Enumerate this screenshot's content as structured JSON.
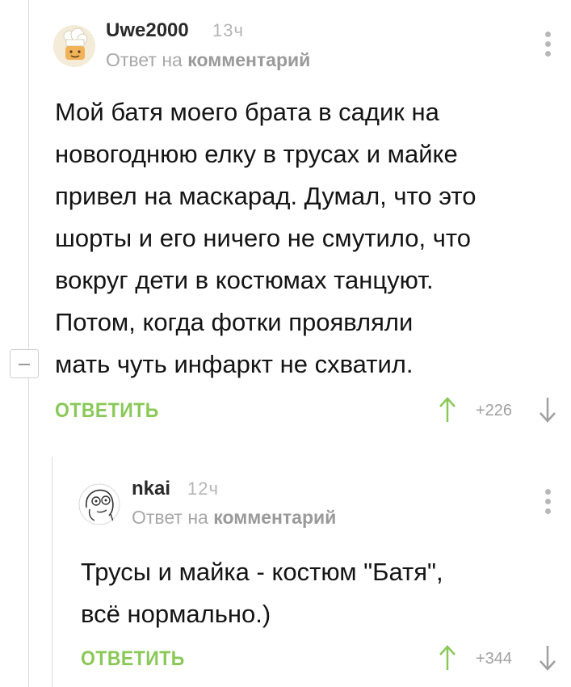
{
  "colors": {
    "accent_green": "#8ac858",
    "muted_gray": "#a8a8a8",
    "text": "#141414"
  },
  "comments": [
    {
      "author": "Uwe2000",
      "time": "13ч",
      "reply_prefix": "Ответ на",
      "reply_target": "комментарий",
      "text_lines": [
        "Мой батя моего брата в садик на",
        "новогоднюю елку в трусах и майке",
        "привел на маскарад. Думал, что это",
        "шорты  и его ничего не смутило, что",
        "вокруг дети в костюмах танцуют.",
        "Потом, когда фотки проявляли",
        "мать чуть инфаркт не схватил."
      ],
      "reply_label": "ОТВЕТИТЬ",
      "score": "+226",
      "avatar_icon": "chef-avatar"
    },
    {
      "author": "nkai",
      "time": "12ч",
      "reply_prefix": "Ответ на",
      "reply_target": "комментарий",
      "text_lines": [
        "Трусы и майка - костюм \"Батя\",",
        "всё нормально.)"
      ],
      "reply_label": "ОТВЕТИТЬ",
      "score": "+344",
      "avatar_icon": "meme-face-avatar"
    }
  ],
  "icons": {
    "more": "more-vertical-icon",
    "upvote": "arrow-up-icon",
    "downvote": "arrow-down-icon",
    "collapse": "collapse-minus-icon"
  }
}
